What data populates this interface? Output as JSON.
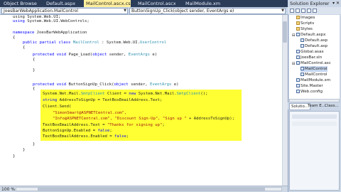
{
  "tabs": [
    {
      "label": "Object Browser",
      "close": ""
    },
    {
      "label": "Default.aspx",
      "close": ""
    },
    {
      "label": "MailControl.ascx.cs",
      "close": "×"
    },
    {
      "label": "MailControl.ascx*",
      "close": ""
    },
    {
      "label": "MailModule.xml",
      "close": ""
    }
  ],
  "navbar": {
    "class_combo": "JoesBarWebApplication.MailControl",
    "method_combo": "ButtonSignUp_Click(object sender, EventArgs e)"
  },
  "code": {
    "l1": "using System.Web.UI;",
    "l2_a": "using ",
    "l2_b": "System.Web.UI.WebControls;",
    "l3_kw": "namespace",
    "l3_rest": " JoesBarWebApplication",
    "l4": "{",
    "l5_kw": "public partial class",
    "l5_ty": "MailControl",
    "l5_sep": " : ",
    "l5_rest": "System.Web.UI.",
    "l5_ty2": "UserControl",
    "l6": "{",
    "l7_kw": "protected void",
    "l7_rest": " Page_Load(",
    "l7_kw2": "object",
    "l7_rest2": " sender, ",
    "l7_ty": "EventArgs",
    "l7_rest3": " e)",
    "l8": "{",
    "l9": "}",
    "l10_kw": "protected void",
    "l10_rest": " ButtonSignUp_Click(",
    "l10_kw2": "object",
    "l10_rest2": " sender, ",
    "l10_ty": "EventArgs",
    "l10_rest3": " e)",
    "l11": "{",
    "h1_a": "System.Net.Mail.",
    "h1_ty": "SmtpClient",
    "h1_b": " Client = ",
    "h1_kw": "new",
    "h1_c": " System.Net.Mail.",
    "h1_ty2": "SmtpClient",
    "h1_d": "();",
    "h2_kw": "string",
    "h2_rest": " AddressToSignUp = TextBoxEmailAddress.Text;",
    "h3": "Client.Send(",
    "h4": "\"SimonSmart@ASPNETCentral.com\",",
    "h5_a": "\"Info@ASPNETCentral.com\", ",
    "h5_b": "\"Discount Sign-Up\", \"Sign up \"",
    "h5_c": " + AddressToSignUp);",
    "h6_a": "TextBoxEmailAddress.Text = ",
    "h6_b": "\"Thanks for signing up\"",
    "h6_c": ";",
    "h7_a": "ButtonSignUp.Enabled = ",
    "h7_kw": "false",
    "h7_c": ";",
    "h8_a": "TextBoxEmailAddress.Enabled = ",
    "h8_kw": "false",
    "h8_c": ";",
    "l12": "}",
    "l13": "}",
    "l14": "}"
  },
  "status": {
    "zoom": "100 %"
  },
  "solution_explorer": {
    "title": "Solution Explorer",
    "pin": "▾ ✕",
    "tree": [
      {
        "label": "Images",
        "indent": 1,
        "icon": "folder"
      },
      {
        "label": "Scripts",
        "indent": 1,
        "icon": "folder"
      },
      {
        "label": "Styles",
        "indent": 1,
        "icon": "folder"
      },
      {
        "label": "Default.aspx",
        "indent": 1,
        "icon": "page"
      },
      {
        "label": "Default.asp",
        "indent": 2,
        "icon": "page"
      },
      {
        "label": "Default.asp",
        "indent": 2,
        "icon": "page"
      },
      {
        "label": "Global.asax",
        "indent": 1,
        "icon": "page"
      },
      {
        "label": "JoesBar.sln",
        "indent": 1,
        "icon": "page"
      },
      {
        "label": "MailControl.asc",
        "indent": 1,
        "icon": "page"
      },
      {
        "label": "MailControl",
        "indent": 2,
        "icon": "page",
        "selected": true
      },
      {
        "label": "MailControl",
        "indent": 2,
        "icon": "page"
      },
      {
        "label": "MailModule.xm",
        "indent": 1,
        "icon": "page"
      },
      {
        "label": "Site.Master",
        "indent": 1,
        "icon": "page"
      },
      {
        "label": "Web.config",
        "indent": 1,
        "icon": "page"
      }
    ],
    "bottom_tabs": [
      "Solutio...",
      "Team E...",
      "Class...",
      ""
    ]
  }
}
